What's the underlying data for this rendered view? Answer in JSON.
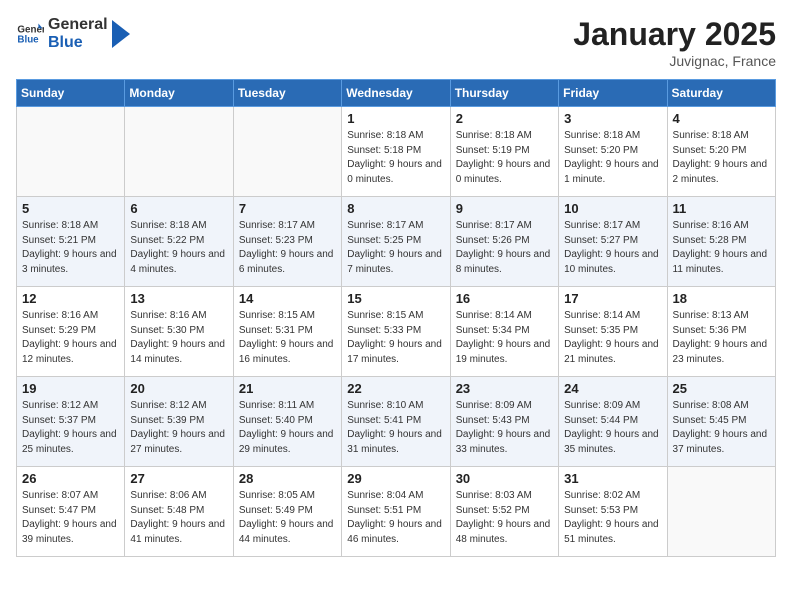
{
  "header": {
    "logo_general": "General",
    "logo_blue": "Blue",
    "month_title": "January 2025",
    "location": "Juvignac, France"
  },
  "weekdays": [
    "Sunday",
    "Monday",
    "Tuesday",
    "Wednesday",
    "Thursday",
    "Friday",
    "Saturday"
  ],
  "weeks": [
    [
      {
        "day": "",
        "sunrise": "",
        "sunset": "",
        "daylight": ""
      },
      {
        "day": "",
        "sunrise": "",
        "sunset": "",
        "daylight": ""
      },
      {
        "day": "",
        "sunrise": "",
        "sunset": "",
        "daylight": ""
      },
      {
        "day": "1",
        "sunrise": "Sunrise: 8:18 AM",
        "sunset": "Sunset: 5:18 PM",
        "daylight": "Daylight: 9 hours and 0 minutes."
      },
      {
        "day": "2",
        "sunrise": "Sunrise: 8:18 AM",
        "sunset": "Sunset: 5:19 PM",
        "daylight": "Daylight: 9 hours and 0 minutes."
      },
      {
        "day": "3",
        "sunrise": "Sunrise: 8:18 AM",
        "sunset": "Sunset: 5:20 PM",
        "daylight": "Daylight: 9 hours and 1 minute."
      },
      {
        "day": "4",
        "sunrise": "Sunrise: 8:18 AM",
        "sunset": "Sunset: 5:20 PM",
        "daylight": "Daylight: 9 hours and 2 minutes."
      }
    ],
    [
      {
        "day": "5",
        "sunrise": "Sunrise: 8:18 AM",
        "sunset": "Sunset: 5:21 PM",
        "daylight": "Daylight: 9 hours and 3 minutes."
      },
      {
        "day": "6",
        "sunrise": "Sunrise: 8:18 AM",
        "sunset": "Sunset: 5:22 PM",
        "daylight": "Daylight: 9 hours and 4 minutes."
      },
      {
        "day": "7",
        "sunrise": "Sunrise: 8:17 AM",
        "sunset": "Sunset: 5:23 PM",
        "daylight": "Daylight: 9 hours and 6 minutes."
      },
      {
        "day": "8",
        "sunrise": "Sunrise: 8:17 AM",
        "sunset": "Sunset: 5:25 PM",
        "daylight": "Daylight: 9 hours and 7 minutes."
      },
      {
        "day": "9",
        "sunrise": "Sunrise: 8:17 AM",
        "sunset": "Sunset: 5:26 PM",
        "daylight": "Daylight: 9 hours and 8 minutes."
      },
      {
        "day": "10",
        "sunrise": "Sunrise: 8:17 AM",
        "sunset": "Sunset: 5:27 PM",
        "daylight": "Daylight: 9 hours and 10 minutes."
      },
      {
        "day": "11",
        "sunrise": "Sunrise: 8:16 AM",
        "sunset": "Sunset: 5:28 PM",
        "daylight": "Daylight: 9 hours and 11 minutes."
      }
    ],
    [
      {
        "day": "12",
        "sunrise": "Sunrise: 8:16 AM",
        "sunset": "Sunset: 5:29 PM",
        "daylight": "Daylight: 9 hours and 12 minutes."
      },
      {
        "day": "13",
        "sunrise": "Sunrise: 8:16 AM",
        "sunset": "Sunset: 5:30 PM",
        "daylight": "Daylight: 9 hours and 14 minutes."
      },
      {
        "day": "14",
        "sunrise": "Sunrise: 8:15 AM",
        "sunset": "Sunset: 5:31 PM",
        "daylight": "Daylight: 9 hours and 16 minutes."
      },
      {
        "day": "15",
        "sunrise": "Sunrise: 8:15 AM",
        "sunset": "Sunset: 5:33 PM",
        "daylight": "Daylight: 9 hours and 17 minutes."
      },
      {
        "day": "16",
        "sunrise": "Sunrise: 8:14 AM",
        "sunset": "Sunset: 5:34 PM",
        "daylight": "Daylight: 9 hours and 19 minutes."
      },
      {
        "day": "17",
        "sunrise": "Sunrise: 8:14 AM",
        "sunset": "Sunset: 5:35 PM",
        "daylight": "Daylight: 9 hours and 21 minutes."
      },
      {
        "day": "18",
        "sunrise": "Sunrise: 8:13 AM",
        "sunset": "Sunset: 5:36 PM",
        "daylight": "Daylight: 9 hours and 23 minutes."
      }
    ],
    [
      {
        "day": "19",
        "sunrise": "Sunrise: 8:12 AM",
        "sunset": "Sunset: 5:37 PM",
        "daylight": "Daylight: 9 hours and 25 minutes."
      },
      {
        "day": "20",
        "sunrise": "Sunrise: 8:12 AM",
        "sunset": "Sunset: 5:39 PM",
        "daylight": "Daylight: 9 hours and 27 minutes."
      },
      {
        "day": "21",
        "sunrise": "Sunrise: 8:11 AM",
        "sunset": "Sunset: 5:40 PM",
        "daylight": "Daylight: 9 hours and 29 minutes."
      },
      {
        "day": "22",
        "sunrise": "Sunrise: 8:10 AM",
        "sunset": "Sunset: 5:41 PM",
        "daylight": "Daylight: 9 hours and 31 minutes."
      },
      {
        "day": "23",
        "sunrise": "Sunrise: 8:09 AM",
        "sunset": "Sunset: 5:43 PM",
        "daylight": "Daylight: 9 hours and 33 minutes."
      },
      {
        "day": "24",
        "sunrise": "Sunrise: 8:09 AM",
        "sunset": "Sunset: 5:44 PM",
        "daylight": "Daylight: 9 hours and 35 minutes."
      },
      {
        "day": "25",
        "sunrise": "Sunrise: 8:08 AM",
        "sunset": "Sunset: 5:45 PM",
        "daylight": "Daylight: 9 hours and 37 minutes."
      }
    ],
    [
      {
        "day": "26",
        "sunrise": "Sunrise: 8:07 AM",
        "sunset": "Sunset: 5:47 PM",
        "daylight": "Daylight: 9 hours and 39 minutes."
      },
      {
        "day": "27",
        "sunrise": "Sunrise: 8:06 AM",
        "sunset": "Sunset: 5:48 PM",
        "daylight": "Daylight: 9 hours and 41 minutes."
      },
      {
        "day": "28",
        "sunrise": "Sunrise: 8:05 AM",
        "sunset": "Sunset: 5:49 PM",
        "daylight": "Daylight: 9 hours and 44 minutes."
      },
      {
        "day": "29",
        "sunrise": "Sunrise: 8:04 AM",
        "sunset": "Sunset: 5:51 PM",
        "daylight": "Daylight: 9 hours and 46 minutes."
      },
      {
        "day": "30",
        "sunrise": "Sunrise: 8:03 AM",
        "sunset": "Sunset: 5:52 PM",
        "daylight": "Daylight: 9 hours and 48 minutes."
      },
      {
        "day": "31",
        "sunrise": "Sunrise: 8:02 AM",
        "sunset": "Sunset: 5:53 PM",
        "daylight": "Daylight: 9 hours and 51 minutes."
      },
      {
        "day": "",
        "sunrise": "",
        "sunset": "",
        "daylight": ""
      }
    ]
  ]
}
